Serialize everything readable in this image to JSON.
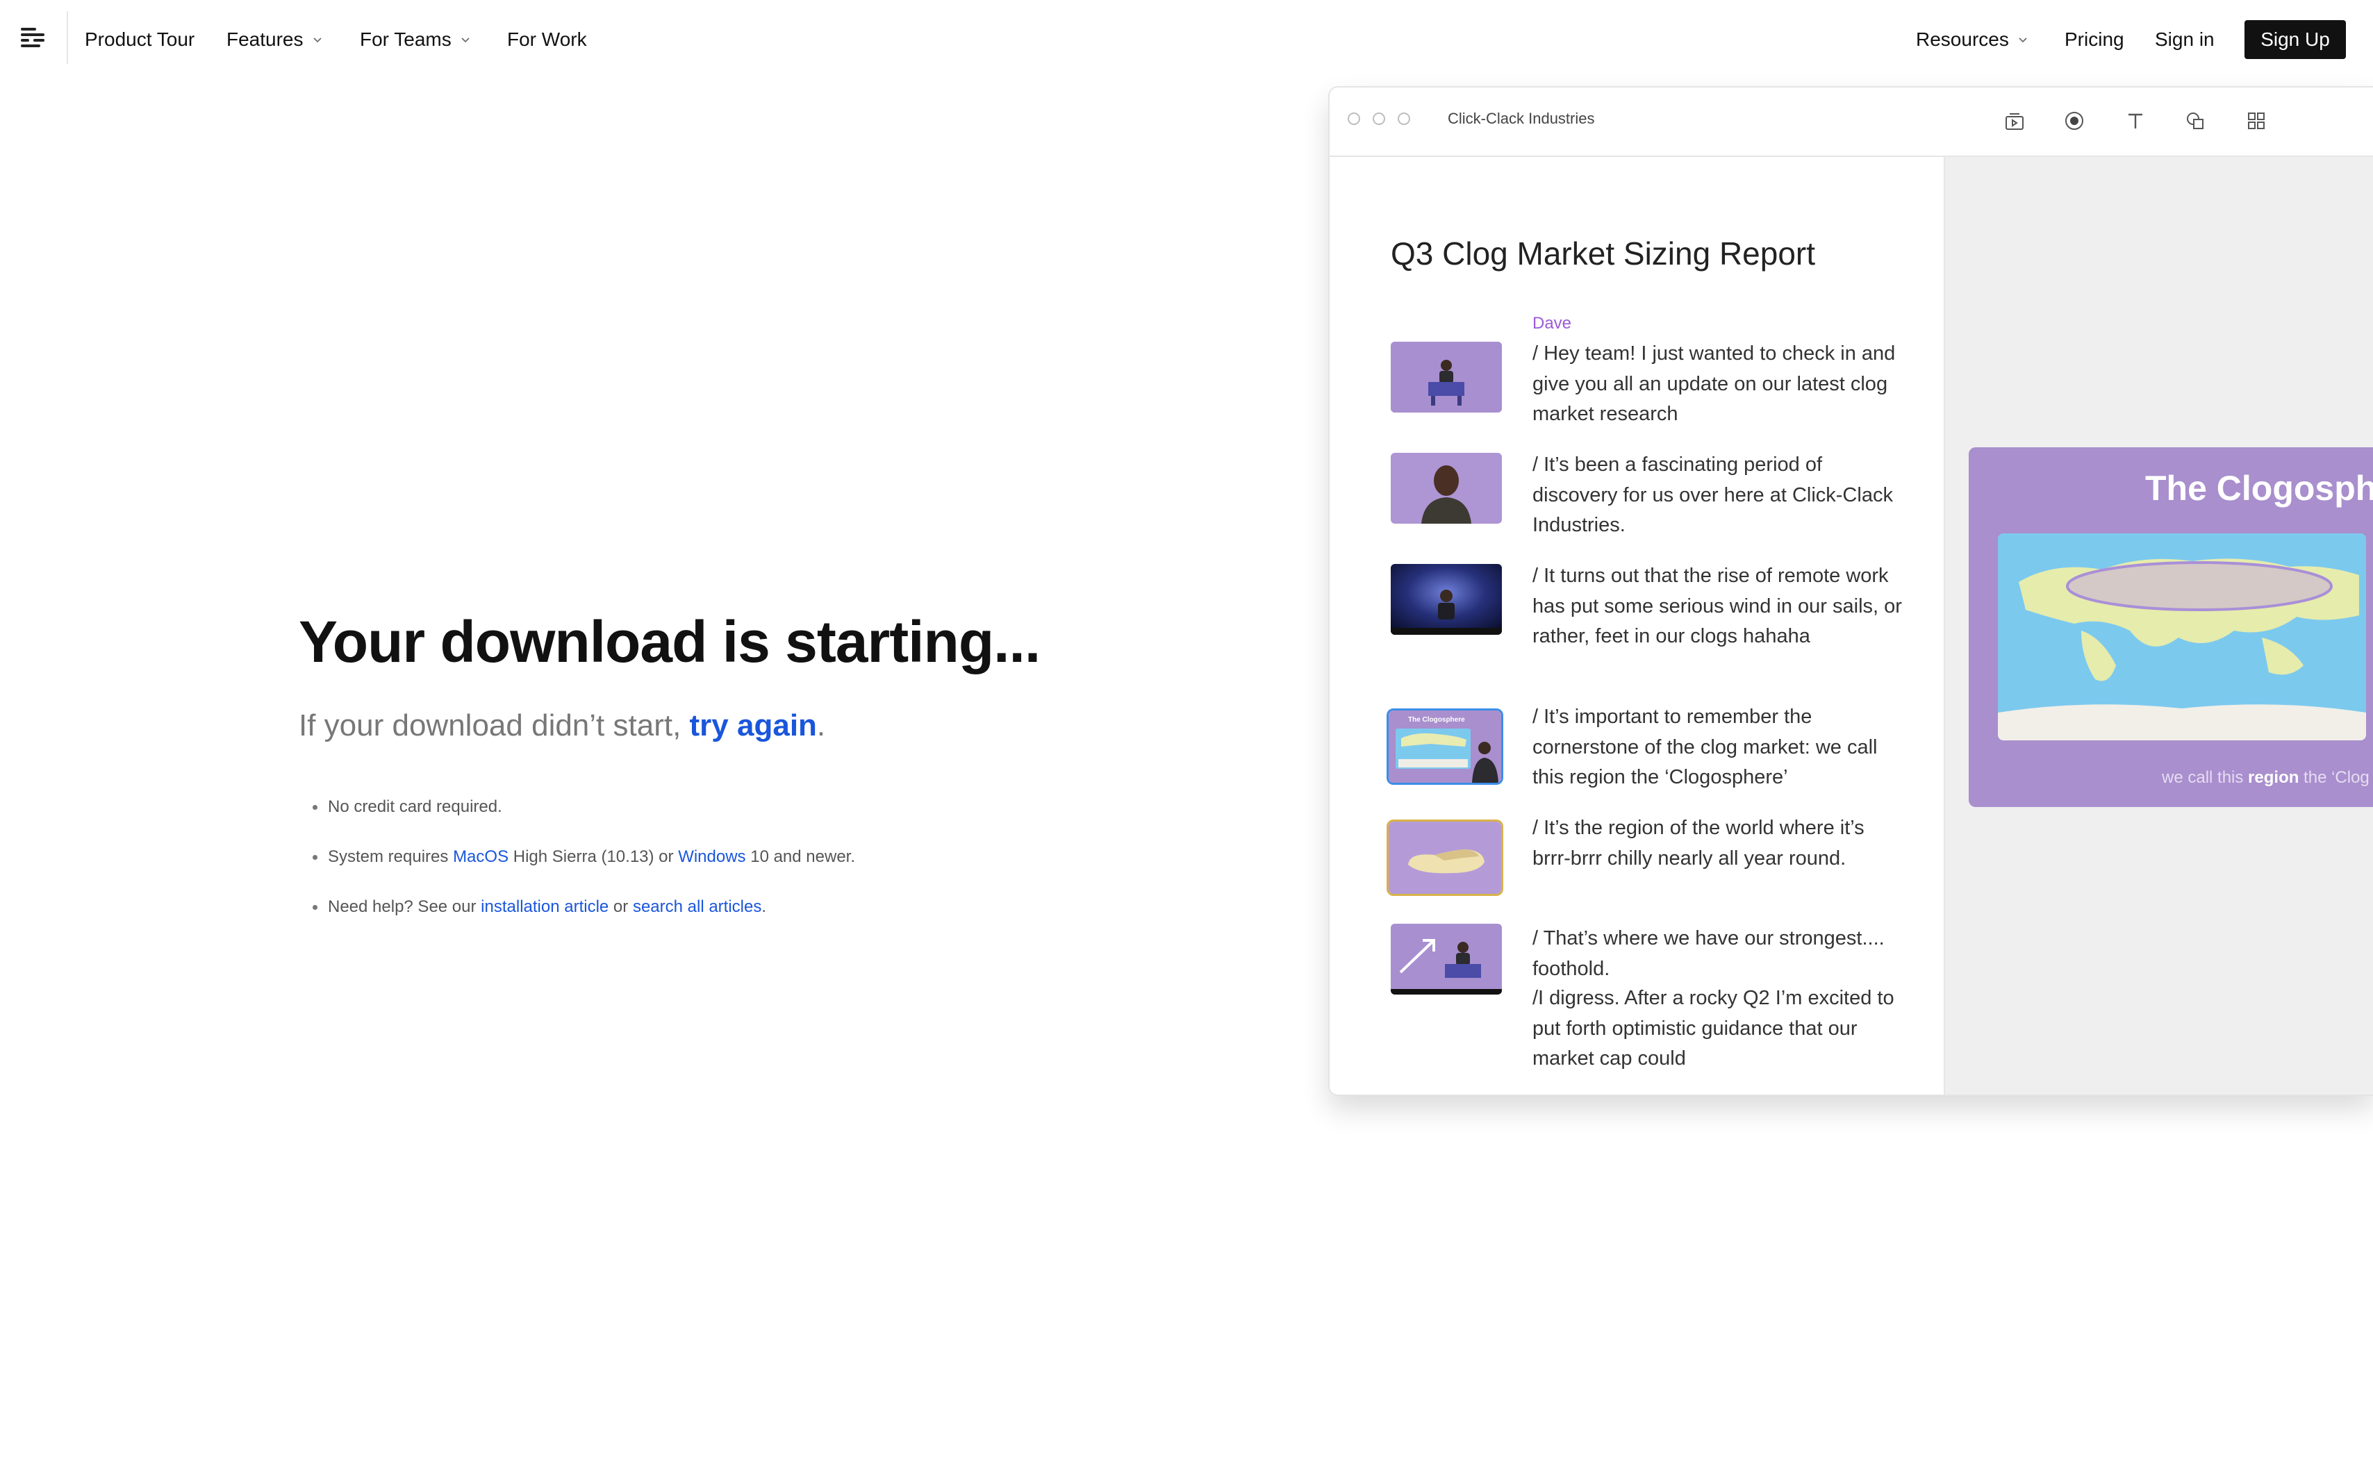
{
  "nav": {
    "items": [
      {
        "label": "Product Tour"
      },
      {
        "label": "Features"
      },
      {
        "label": "For Teams"
      },
      {
        "label": "For Work"
      }
    ],
    "resources": "Resources",
    "pricing": "Pricing",
    "signin": "Sign in",
    "signup": "Sign Up"
  },
  "hero": {
    "headline": "Your download is starting...",
    "sub_prefix": "If your download didn’t start, ",
    "sub_link": "try again",
    "sub_suffix": "."
  },
  "bullets": {
    "b1": "No credit card required.",
    "b2_prefix": "System requires ",
    "b2_link1": "MacOS",
    "b2_mid": " High Sierra (10.13) or ",
    "b2_link2": "Windows",
    "b2_suffix": " 10 and newer.",
    "b3_prefix": "Need help? See our ",
    "b3_link1": "installation article",
    "b3_mid": " or ",
    "b3_link2": "search all articles",
    "b3_suffix": "."
  },
  "app": {
    "window_title": "Click-Clack Industries",
    "doc_title": "Q3 Clog Market Sizing Report",
    "speaker": "Dave",
    "paragraphs": [
      "/ Hey team! I just wanted to check in and give you all an update on our latest clog market research",
      "/ It’s been a fascinating period of discovery for us over here at Click-Clack Industries.",
      "/ It turns out that the rise of remote work has put some serious wind in our sails, or rather, feet in our clogs hahaha",
      "/ It’s important to remember the cornerstone of the clog market: we call this region the ‘Clogosphere’",
      "/ It’s the region of the world where it’s brrr-brrr chilly nearly all year round.",
      "/ That’s where we have our strongest.... foothold.",
      "/I digress. After a rocky Q2 I’m excited to put forth optimistic guidance that our market cap could"
    ],
    "thumb_slide_title": "The Clogosphere",
    "slide": {
      "title": "The Clogosph",
      "caption_prefix": "we call this ",
      "caption_bold": "region",
      "caption_suffix": " the ‘Clog"
    }
  },
  "colors": {
    "link": "#1a56db",
    "speaker": "#9b5bd6",
    "slide_bg": "#a98fcd",
    "select_blue": "#3c8ee8",
    "select_gold": "#d8b24a"
  }
}
